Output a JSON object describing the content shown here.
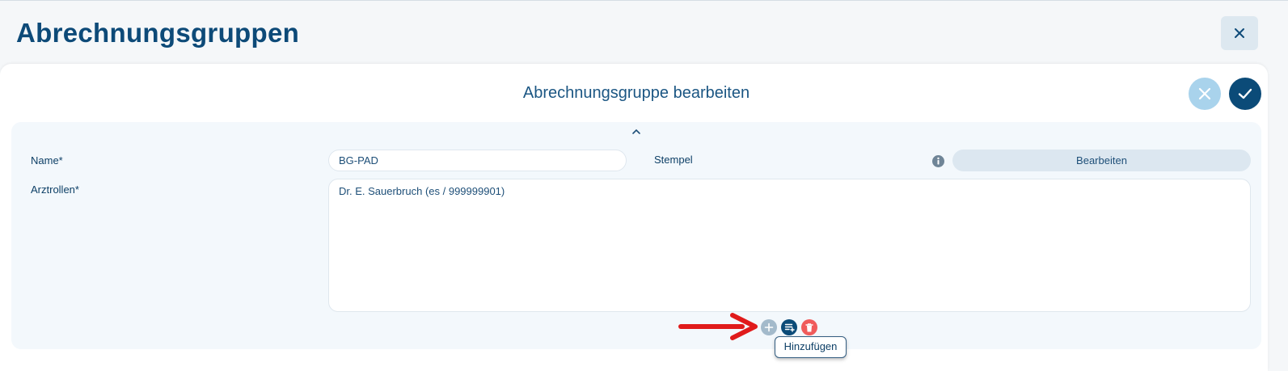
{
  "page": {
    "title": "Abrechnungsgruppen"
  },
  "panel": {
    "title": "Abrechnungsgruppe bearbeiten"
  },
  "form": {
    "name_label": "Name*",
    "name_value": "BG-PAD",
    "stamp_label": "Stempel",
    "stamp_button": "Bearbeiten",
    "roles_label": "Arztrollen*",
    "roles": [
      "Dr. E. Sauerbruch (es / 999999901)"
    ]
  },
  "actions": {
    "tooltip": "Hinzufügen"
  },
  "colors": {
    "primary": "#0b4b78",
    "cancel_bg": "#a9d3ec",
    "delete": "#f05b5b",
    "arrow": "#e01b1b"
  },
  "icons": [
    "close-icon",
    "cancel-icon",
    "check-icon",
    "chevron-up-icon",
    "info-icon",
    "plus-icon",
    "list-add-icon",
    "trash-icon",
    "arrow-right-icon"
  ]
}
